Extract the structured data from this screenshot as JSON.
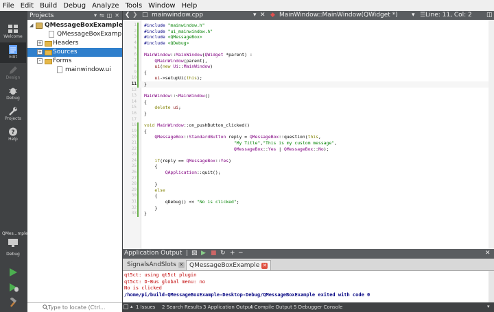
{
  "menu": [
    "File",
    "Edit",
    "Build",
    "Debug",
    "Analyze",
    "Tools",
    "Window",
    "Help"
  ],
  "modes": [
    {
      "label": "Welcome",
      "icon": "grid-icon",
      "active": false,
      "disabled": false
    },
    {
      "label": "Edit",
      "icon": "document-edit-icon",
      "active": true,
      "disabled": false
    },
    {
      "label": "Design",
      "icon": "pencil-design-icon",
      "active": false,
      "disabled": true
    },
    {
      "label": "Debug",
      "icon": "bug-icon",
      "active": false,
      "disabled": false
    },
    {
      "label": "Projects",
      "icon": "wrench-icon",
      "active": false,
      "disabled": false
    },
    {
      "label": "Help",
      "icon": "help-icon",
      "active": false,
      "disabled": false
    }
  ],
  "kit": {
    "target": "QMes...mple",
    "build": "Debug"
  },
  "projects": {
    "title": "Projects",
    "tree": [
      {
        "text": "QMessageBoxExample",
        "level": 0,
        "type": "project",
        "bold": true,
        "expander": "open"
      },
      {
        "text": "QMessageBoxExample.pro",
        "level": 1,
        "type": "file",
        "expander": ""
      },
      {
        "text": "Headers",
        "level": 1,
        "type": "folder",
        "expander": "+"
      },
      {
        "text": "Sources",
        "level": 1,
        "type": "folder",
        "expander": "+",
        "selected": true
      },
      {
        "text": "Forms",
        "level": 1,
        "type": "folder",
        "expander": "-"
      },
      {
        "text": "mainwindow.ui",
        "level": 2,
        "type": "file",
        "expander": ""
      }
    ]
  },
  "locator": {
    "placeholder": "Type to locate (Ctrl..."
  },
  "editor_toolbar": {
    "file": "mainwindow.cpp",
    "symbol": "MainWindow::MainWindow(QWidget *)",
    "position": "Line: 11, Col: 2"
  },
  "editor": {
    "current_line": 11,
    "lines": [
      [
        [
          "#include ",
          "#000080"
        ],
        [
          "\"mainwindow.h\"",
          "#008000"
        ]
      ],
      [
        [
          "#include ",
          "#000080"
        ],
        [
          "\"ui_mainwindow.h\"",
          "#008000"
        ]
      ],
      [
        [
          "#include ",
          "#000080"
        ],
        [
          "<QMessageBox>",
          "#008000"
        ]
      ],
      [
        [
          "#include ",
          "#000080"
        ],
        [
          "<QDebug>",
          "#008000"
        ]
      ],
      [],
      [
        [
          "MainWindow",
          "#800080"
        ],
        [
          "::",
          "#000"
        ],
        [
          "MainWindow",
          "#800080"
        ],
        [
          "(",
          "#000"
        ],
        [
          "QWidget",
          "#800080"
        ],
        [
          " *parent) :",
          "#000"
        ]
      ],
      [
        [
          "    ",
          "#000"
        ],
        [
          "QMainWindow",
          "#800080"
        ],
        [
          "(parent),",
          "#000"
        ]
      ],
      [
        [
          "    ",
          "#000"
        ],
        [
          "ui",
          "#800000"
        ],
        [
          "(",
          "#000"
        ],
        [
          "new ",
          "#808000"
        ],
        [
          "Ui",
          "#800080"
        ],
        [
          "::",
          "#000"
        ],
        [
          "MainWindow",
          "#800080"
        ],
        [
          ")",
          "#000"
        ]
      ],
      [
        [
          "{",
          "#000"
        ]
      ],
      [
        [
          "    ",
          "#000"
        ],
        [
          "ui",
          "#800000"
        ],
        [
          "->setupUi(",
          "#000"
        ],
        [
          "this",
          "#808000"
        ],
        [
          ");",
          "#000"
        ]
      ],
      [
        [
          "}",
          "#000"
        ]
      ],
      [],
      [
        [
          "MainWindow",
          "#800080"
        ],
        [
          "::~",
          "#000"
        ],
        [
          "MainWindow",
          "#800080"
        ],
        [
          "()",
          "#000"
        ]
      ],
      [
        [
          "{",
          "#000"
        ]
      ],
      [
        [
          "    ",
          "#000"
        ],
        [
          "delete ",
          "#808000"
        ],
        [
          "ui",
          "#800000"
        ],
        [
          ";",
          "#000"
        ]
      ],
      [
        [
          "}",
          "#000"
        ]
      ],
      [],
      [
        [
          "void ",
          "#808000"
        ],
        [
          "MainWindow",
          "#800080"
        ],
        [
          "::on_pushButton_clicked()",
          "#000"
        ]
      ],
      [
        [
          "{",
          "#000"
        ]
      ],
      [
        [
          "    ",
          "#000"
        ],
        [
          "QMessageBox",
          "#800080"
        ],
        [
          "::",
          "#000"
        ],
        [
          "StandardButton",
          "#800080"
        ],
        [
          " reply = ",
          "#000"
        ],
        [
          "QMessageBox",
          "#800080"
        ],
        [
          "::question(",
          "#000"
        ],
        [
          "this",
          "#808000"
        ],
        [
          ",",
          "#000"
        ]
      ],
      [
        [
          "                                  ",
          "#000"
        ],
        [
          "\"My Title\"",
          "#008000"
        ],
        [
          ",",
          "#000"
        ],
        [
          "\"This is my custom message\"",
          "#008000"
        ],
        [
          ",",
          "#000"
        ]
      ],
      [
        [
          "                                  ",
          "#000"
        ],
        [
          "QMessageBox",
          "#800080"
        ],
        [
          "::",
          "#000"
        ],
        [
          "Yes",
          "#800080"
        ],
        [
          " | ",
          "#000"
        ],
        [
          "QMessageBox",
          "#800080"
        ],
        [
          "::",
          "#000"
        ],
        [
          "No",
          "#800080"
        ],
        [
          ");",
          "#000"
        ]
      ],
      [],
      [
        [
          "    ",
          "#000"
        ],
        [
          "if",
          "#808000"
        ],
        [
          "(reply == ",
          "#000"
        ],
        [
          "QMessageBox",
          "#800080"
        ],
        [
          "::",
          "#000"
        ],
        [
          "Yes",
          "#800080"
        ],
        [
          ")",
          "#000"
        ]
      ],
      [
        [
          "    {",
          "#000"
        ]
      ],
      [
        [
          "        ",
          "#000"
        ],
        [
          "QApplication",
          "#800080"
        ],
        [
          "::quit();",
          "#000"
        ]
      ],
      [],
      [
        [
          "    }",
          "#000"
        ]
      ],
      [
        [
          "    ",
          "#000"
        ],
        [
          "else",
          "#808000"
        ]
      ],
      [
        [
          "    {",
          "#000"
        ]
      ],
      [
        [
          "        ",
          "#000"
        ],
        [
          "qDebug",
          "#000"
        ],
        [
          "() << ",
          "#000"
        ],
        [
          "\"No is clicked\"",
          "#008000"
        ],
        [
          ";",
          "#000"
        ]
      ],
      [
        [
          "    }",
          "#000"
        ]
      ],
      [
        [
          "}",
          "#000"
        ]
      ]
    ]
  },
  "output_pane": {
    "title": "Application Output",
    "tabs": [
      {
        "label": "SignalsAndSlots",
        "active": false
      },
      {
        "label": "QMessageBoxExample",
        "active": true
      }
    ],
    "lines": [
      {
        "text": "qt5ct: using qt5ct plugin",
        "color": "#c00000"
      },
      {
        "text": "qt5ct: D-Bus global menu: no",
        "color": "#c00000"
      },
      {
        "text": "No is clicked",
        "color": "#c00000"
      },
      {
        "text": "/home/pi/build-QMessageBoxExample-Desktop-Debug/QMessageBoxExample exited with code 0",
        "color": "#000080"
      }
    ]
  },
  "statusbar": [
    "1  Issues",
    "2  Search Results",
    "3  Application Output",
    "4  Compile Output",
    "5  Debugger Console"
  ],
  "colors": {
    "accent": "#2f7fcc",
    "sidebar": "#404244",
    "toolbar": "#5a5d60",
    "run_green": "#4caf50"
  }
}
